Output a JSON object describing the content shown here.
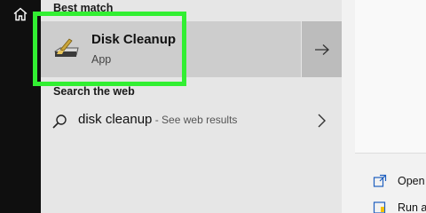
{
  "sidebar": {
    "home_icon": "home-icon"
  },
  "best_match": {
    "heading": "Best match",
    "app_name": "Disk Cleanup",
    "app_type": "App",
    "app_icon": "disk-cleanup-icon",
    "open_arrow_icon": "arrow-right-icon",
    "highlight_color": "#32ef32"
  },
  "web": {
    "heading": "Search the web",
    "query": "disk cleanup",
    "suffix": " - See web results",
    "search_icon": "search-icon",
    "chevron_icon": "chevron-right-icon"
  },
  "actions": {
    "open_label": "Open",
    "run_label": "Run a"
  }
}
